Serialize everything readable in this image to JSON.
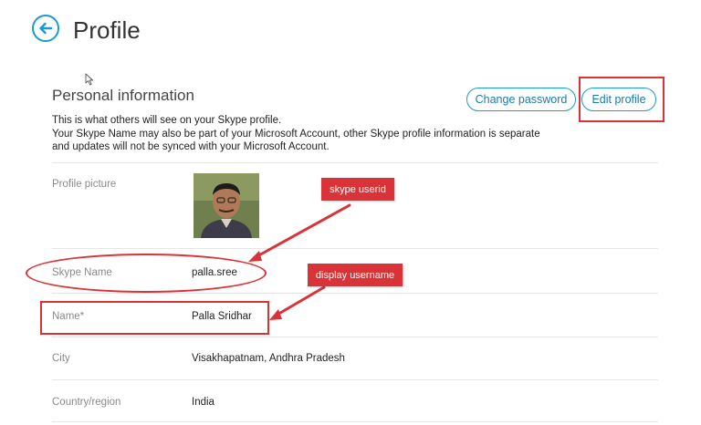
{
  "header": {
    "back_icon": "arrow-left-icon",
    "title": "Profile"
  },
  "section": {
    "title": "Personal information",
    "change_password_label": "Change password",
    "edit_profile_label": "Edit profile",
    "intro_line1": "This is what others will see on your Skype profile.",
    "intro_line2": "Your Skype Name may also be part of your Microsoft Account, other Skype profile information is separate",
    "intro_line3": "and updates will not be synced with your Microsoft Account."
  },
  "rows": {
    "profile_picture": {
      "label": "Profile picture"
    },
    "skype_name": {
      "label": "Skype Name",
      "value": "palla.sree"
    },
    "name": {
      "label": "Name*",
      "value": "Palla Sridhar"
    },
    "city": {
      "label": "City",
      "value": "Visakhapatnam, Andhra Pradesh"
    },
    "country": {
      "label": "Country/region",
      "value": "India"
    }
  },
  "annotations": {
    "skype_userid": "skype userid",
    "display_username": "display username"
  },
  "colors": {
    "accent": "#1a9ad6",
    "annotation_red": "#d93337"
  }
}
